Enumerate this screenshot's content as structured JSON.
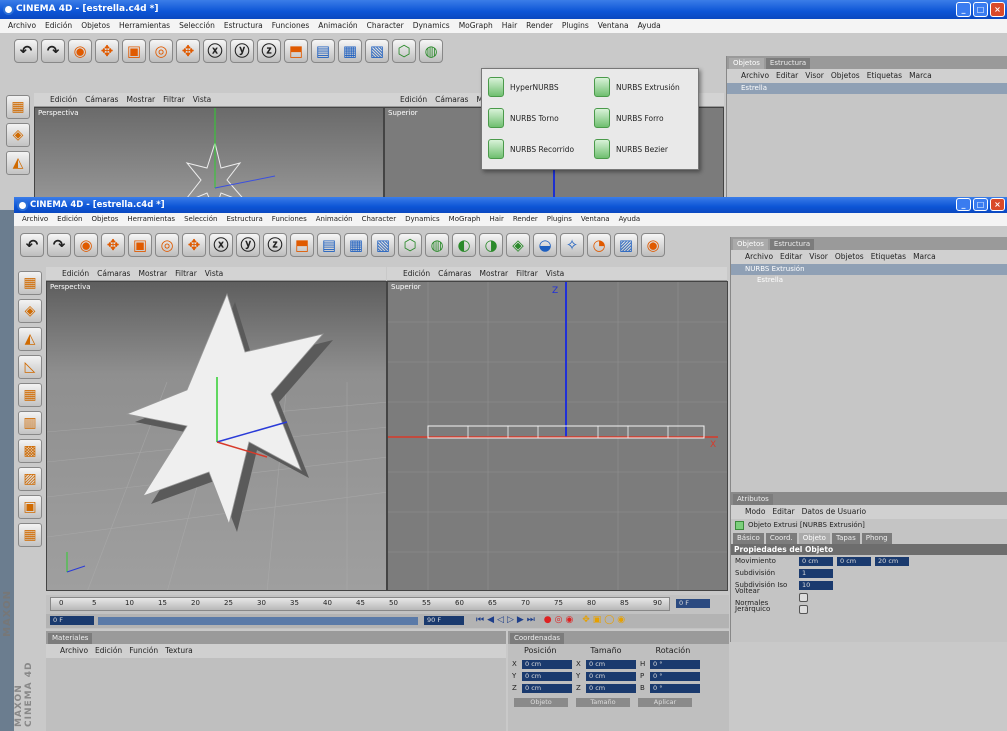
{
  "back": {
    "title": "CINEMA 4D - [estrella.c4d *]",
    "menu": [
      "Archivo",
      "Edición",
      "Objetos",
      "Herramientas",
      "Selección",
      "Estructura",
      "Funciones",
      "Animación",
      "Character",
      "Dynamics",
      "MoGraph",
      "Hair",
      "Render",
      "Plugins",
      "Ventana",
      "Ayuda"
    ],
    "viewport_menu": [
      "Edición",
      "Cámaras",
      "Mostrar",
      "Filtrar",
      "Vista"
    ],
    "viewport2_menu": [
      "Edición",
      "Cámaras",
      "Mos"
    ],
    "viewport_label": "Perspectiva",
    "viewport2_label": "Superior",
    "obj_tabs": [
      "Objetos",
      "Estructura"
    ],
    "obj_menu": [
      "Archivo",
      "Editar",
      "Visor",
      "Objetos",
      "Etiquetas",
      "Marca"
    ],
    "obj_items": [
      "Estrella"
    ]
  },
  "popup": {
    "items": [
      "HyperNURBS",
      "NURBS Extrusión",
      "NURBS Torno",
      "NURBS Forro",
      "NURBS Recorrido",
      "NURBS Bezier"
    ]
  },
  "front": {
    "title": "CINEMA 4D - [estrella.c4d *]",
    "menu": [
      "Archivo",
      "Edición",
      "Objetos",
      "Herramientas",
      "Selección",
      "Estructura",
      "Funciones",
      "Animación",
      "Character",
      "Dynamics",
      "MoGraph",
      "Hair",
      "Render",
      "Plugins",
      "Ventana",
      "Ayuda"
    ],
    "viewport_menu": [
      "Edición",
      "Cámaras",
      "Mostrar",
      "Filtrar",
      "Vista"
    ],
    "viewport2_menu": [
      "Edición",
      "Cámaras",
      "Mostrar",
      "Filtrar",
      "Vista"
    ],
    "viewport_label": "Perspectiva",
    "viewport2_label": "Superior",
    "obj_tabs": [
      "Objetos",
      "Estructura"
    ],
    "obj_menu": [
      "Archivo",
      "Editar",
      "Visor",
      "Objetos",
      "Etiquetas",
      "Marca"
    ],
    "obj_items": [
      "NURBS Extrusión",
      "Estrella"
    ],
    "attr_title": "Atributos",
    "attr_menu": [
      "Modo",
      "Editar",
      "Datos de Usuario"
    ],
    "attr_obj": "Objeto Extrusi [NURBS Extrusión]",
    "attr_tabs": [
      "Básico",
      "Coord.",
      "Objeto",
      "Tapas",
      "Phong"
    ],
    "prop_header": "Propiedades del Objeto",
    "props": [
      {
        "label": "Movimiento",
        "vals": [
          "0 cm",
          "0 cm",
          "20 cm"
        ]
      },
      {
        "label": "Subdivisión",
        "vals": [
          "1"
        ]
      },
      {
        "label": "Subdivisión Iso",
        "vals": [
          "10"
        ]
      },
      {
        "label": "Voltear Normales",
        "vals": []
      },
      {
        "label": "Jerárquico",
        "vals": []
      }
    ],
    "timeline_ticks": [
      "0",
      "5",
      "10",
      "15",
      "20",
      "25",
      "30",
      "35",
      "40",
      "45",
      "50",
      "55",
      "60",
      "65",
      "70",
      "75",
      "80",
      "85",
      "90"
    ],
    "timeline_end": "0 F",
    "frame_start": "0 F",
    "frame_end": "90 F",
    "materials_title": "Materiales",
    "materials_menu": [
      "Archivo",
      "Edición",
      "Función",
      "Textura"
    ],
    "coords_title": "Coordenadas",
    "coords_cols": [
      "Posición",
      "Tamaño",
      "Rotación"
    ],
    "coords_rows": [
      {
        "a": "X",
        "p": "0 cm",
        "s": "0 cm",
        "r": "H",
        "rv": "0 °"
      },
      {
        "a": "Y",
        "p": "0 cm",
        "s": "0 cm",
        "r": "P",
        "rv": "0 °"
      },
      {
        "a": "Z",
        "p": "0 cm",
        "s": "0 cm",
        "r": "B",
        "rv": "0 °"
      }
    ],
    "coords_buttons": [
      "Objeto",
      "Tamaño",
      "Aplicar"
    ],
    "axis_x": "X",
    "axis_z": "Z",
    "brand": "MAXON CINEMA 4D",
    "brand_back": "MAXON"
  }
}
